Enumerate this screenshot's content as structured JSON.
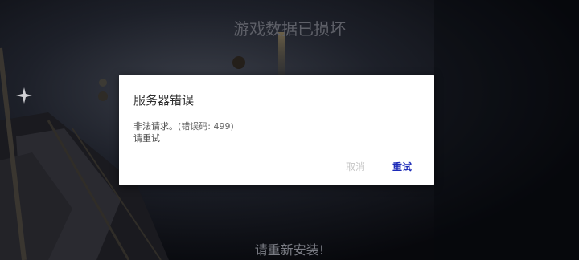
{
  "screen": {
    "title": "游戏数据已损坏",
    "footer": "请重新安装!"
  },
  "dialog": {
    "title": "服务器错误",
    "message_line1": "非法请求。",
    "error_code_text": "(错误码: 499)",
    "message_line2": "请重试",
    "cancel_label": "取消",
    "retry_label": "重试"
  },
  "colors": {
    "background": "#0a0c12",
    "dialog_bg": "#ffffff",
    "retry_accent": "#1d2bb8",
    "cancel_disabled": "#c4c4c4"
  },
  "icons": [
    "sparkle-icon"
  ]
}
